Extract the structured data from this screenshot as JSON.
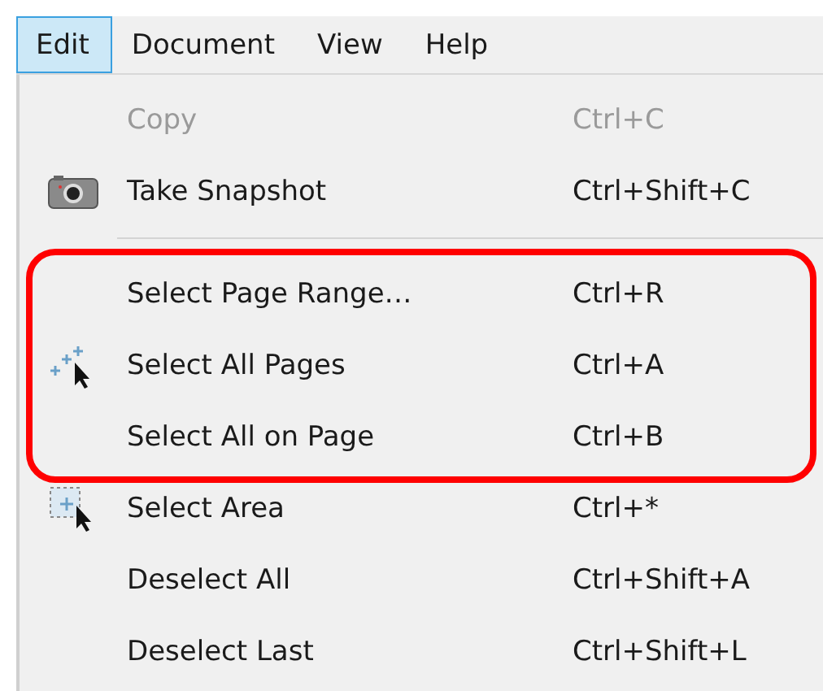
{
  "menubar": [
    {
      "label": "Edit",
      "selected": true
    },
    {
      "label": "Document",
      "selected": false
    },
    {
      "label": "View",
      "selected": false
    },
    {
      "label": "Help",
      "selected": false
    }
  ],
  "menu": {
    "blocks": [
      {
        "kind": "items",
        "highlighted": false,
        "items": [
          {
            "kind": "plain",
            "label": "Copy",
            "shortcut": "Ctrl+C",
            "disabled": true
          },
          {
            "kind": "snapshot",
            "label": "Take Snapshot",
            "shortcut": "Ctrl+Shift+C",
            "disabled": false
          }
        ]
      },
      {
        "kind": "separator"
      },
      {
        "kind": "items",
        "highlighted": true,
        "items": [
          {
            "kind": "plain",
            "label": "Select Page Range…",
            "shortcut": "Ctrl+R",
            "disabled": false
          },
          {
            "kind": "select-all",
            "label": "Select All Pages",
            "shortcut": "Ctrl+A",
            "disabled": false
          },
          {
            "kind": "plain",
            "label": "Select All on Page",
            "shortcut": "Ctrl+B",
            "disabled": false
          }
        ]
      },
      {
        "kind": "items",
        "highlighted": false,
        "items": [
          {
            "kind": "select-area",
            "label": "Select Area",
            "shortcut": "Ctrl+*",
            "disabled": false
          },
          {
            "kind": "plain",
            "label": "Deselect All",
            "shortcut": "Ctrl+Shift+A",
            "disabled": false
          },
          {
            "kind": "plain",
            "label": "Deselect Last",
            "shortcut": "Ctrl+Shift+L",
            "disabled": false
          }
        ]
      }
    ]
  }
}
